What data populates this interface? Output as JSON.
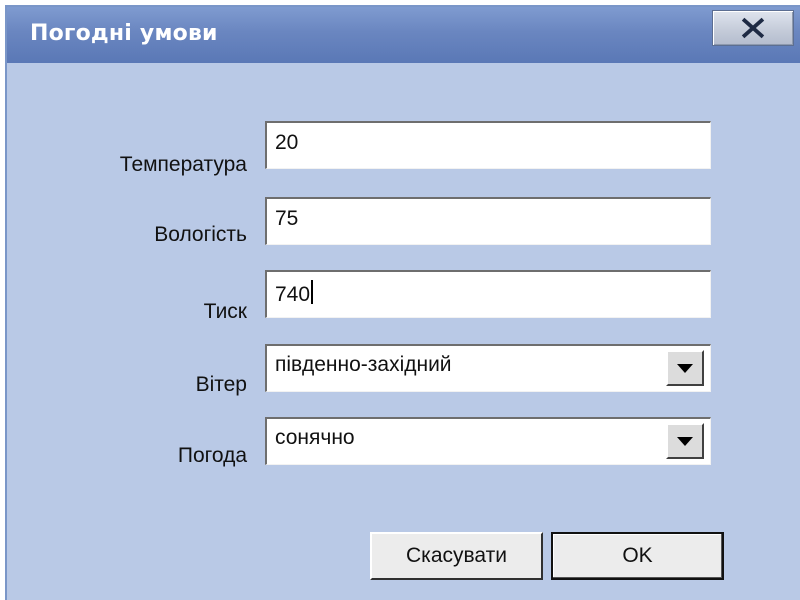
{
  "window": {
    "title": "Погодні умови",
    "close_label": "X"
  },
  "form": {
    "temperature": {
      "label": "Температура",
      "value": "20"
    },
    "humidity": {
      "label": "Вологість",
      "value": "75"
    },
    "pressure": {
      "label": "Тиск",
      "value": "740"
    },
    "wind": {
      "label": "Вітер",
      "value": "південно-західний"
    },
    "weather": {
      "label": "Погода",
      "value": "сонячно"
    }
  },
  "buttons": {
    "cancel_label": "Скасувати",
    "ok_label": "OK"
  },
  "icons": {
    "close": "close-icon",
    "dropdown": "chevron-down-icon"
  },
  "colors": {
    "titlebar": "#6a86c0",
    "dialog_background": "#b9c9e6"
  }
}
